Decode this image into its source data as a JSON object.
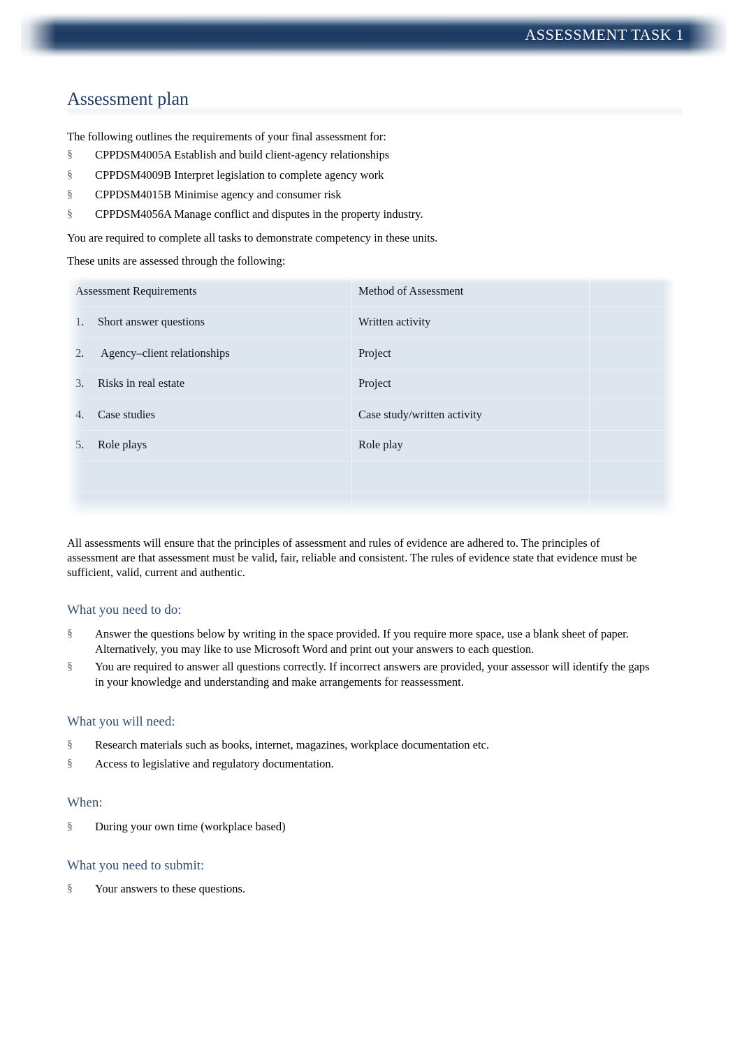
{
  "header": {
    "banner_title": "ASSESSMENT TASK 1"
  },
  "document": {
    "title": "Assessment plan",
    "intro": "The following outlines the requirements of your final assessment for:",
    "units": [
      "CPPDSM4005A Establish and build client-agency relationships",
      "CPPDSM4009B Interpret legislation to complete agency work",
      "CPPDSM4015B Minimise agency and consumer risk",
      "CPPDSM4056A Manage conflict and disputes in the property industry."
    ],
    "competency_note": "You are required to complete all tasks to demonstrate competency in these units.",
    "assessed_note": "These units are assessed through the following:",
    "principles_paragraph": "All assessments will ensure that the principles of assessment and rules of evidence are adhered to. The principles of assessment are that assessment must be valid, fair, reliable and consistent. The rules of evidence state that evidence must be sufficient, valid, current and authentic."
  },
  "table": {
    "headers": [
      "Assessment Requirements",
      "Method of Assessment",
      ""
    ],
    "rows": [
      {
        "number": "1.",
        "requirement": "Short answer questions",
        "method": "Written activity",
        "extra": ""
      },
      {
        "number": "2.",
        "requirement": "Agency–client relationships",
        "method": "Project",
        "extra": ""
      },
      {
        "number": "3.",
        "requirement": "Risks in real estate",
        "method": "Project",
        "extra": ""
      },
      {
        "number": "4.",
        "requirement": "Case studies",
        "method": "Case study/written activity",
        "extra": ""
      },
      {
        "number": "5.",
        "requirement": "Role plays",
        "method": "Role play",
        "extra": ""
      },
      {
        "number": "",
        "requirement": "",
        "method": "",
        "extra": ""
      },
      {
        "number": "",
        "requirement": "",
        "method": "",
        "extra": ""
      }
    ]
  },
  "sections": [
    {
      "heading": "What you need to do:",
      "items": [
        "Answer the questions below by writing in the space provided. If you require more space, use a blank sheet of paper. Alternatively, you may like to use Microsoft Word and print out your answers to each question.",
        "You are required to answer all questions correctly. If incorrect answers are provided, your assessor will identify the gaps in your knowledge and understanding and make arrangements for reassessment."
      ]
    },
    {
      "heading": "What you will need:",
      "items": [
        "Research materials such as books, internet, magazines, workplace documentation etc.",
        "Access to legislative and regulatory documentation."
      ]
    },
    {
      "heading": "When:",
      "items": [
        "During your own time (workplace based)"
      ]
    },
    {
      "heading": "What you need to submit:",
      "items": [
        "Your answers to these questions."
      ]
    }
  ],
  "bullet_glyph": "§",
  "colors": {
    "banner_navy": "#1b3a62",
    "title_navy": "#1f3864",
    "section_heading": "#2e5077",
    "bullet": "#4a6287",
    "table_bg": "#dde5ee"
  }
}
